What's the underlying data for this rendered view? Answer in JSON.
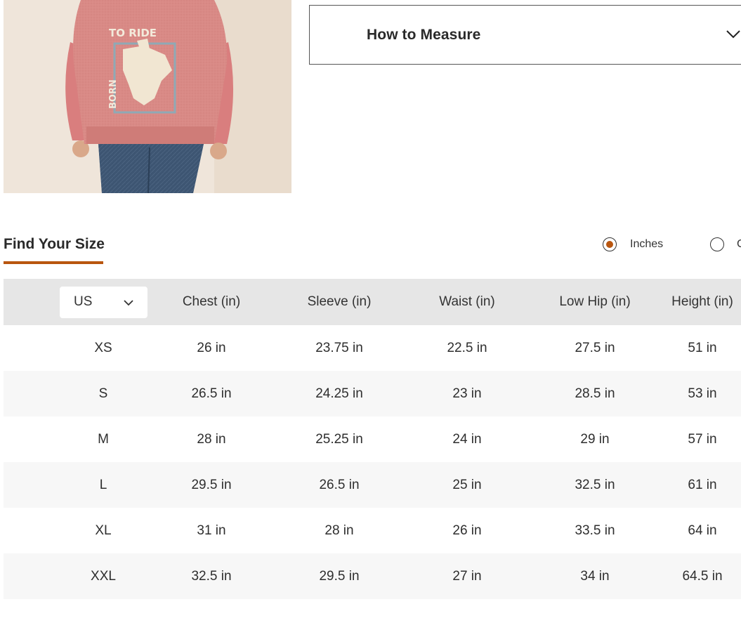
{
  "product": {
    "image_alt": "Girl wearing pink sweatshirt with cowboy graphic",
    "graphic_text_top": "TO RIDE",
    "graphic_text_side": "BORN"
  },
  "accordion": {
    "title": "How to Measure",
    "icon": "chevron-down-icon"
  },
  "find_size": {
    "title": "Find Your Size",
    "accent_color": "#b9560f"
  },
  "units": {
    "options": [
      {
        "label": "Inches",
        "selected": true
      },
      {
        "label": "C",
        "selected": false
      }
    ]
  },
  "table": {
    "size_system": "US",
    "columns": [
      "Chest (in)",
      "Sleeve (in)",
      "Waist (in)",
      "Low Hip (in)",
      "Height (in)"
    ],
    "rows": [
      {
        "size": "XS",
        "values": [
          "26 in",
          "23.75 in",
          "22.5 in",
          "27.5 in",
          "51 in"
        ]
      },
      {
        "size": "S",
        "values": [
          "26.5 in",
          "24.25 in",
          "23 in",
          "28.5 in",
          "53 in"
        ]
      },
      {
        "size": "M",
        "values": [
          "28 in",
          "25.25 in",
          "24 in",
          "29 in",
          "57 in"
        ]
      },
      {
        "size": "L",
        "values": [
          "29.5 in",
          "26.5 in",
          "25 in",
          "32.5 in",
          "61 in"
        ]
      },
      {
        "size": "XL",
        "values": [
          "31 in",
          "28 in",
          "26 in",
          "33.5 in",
          "64 in"
        ]
      },
      {
        "size": "XXL",
        "values": [
          "32.5 in",
          "29.5 in",
          "27 in",
          "34 in",
          "64.5 in"
        ]
      }
    ]
  }
}
